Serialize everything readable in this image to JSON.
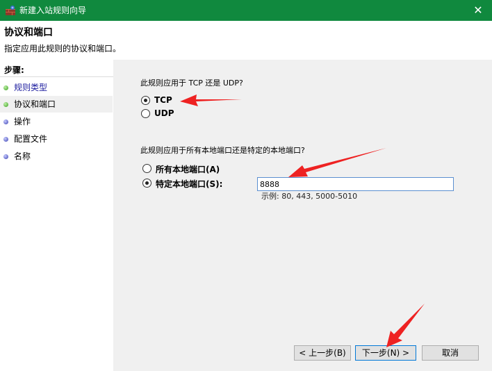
{
  "window": {
    "title": "新建入站规则向导",
    "close_glyph": "✕"
  },
  "header": {
    "title": "协议和端口",
    "subtitle": "指定应用此规则的协议和端口。"
  },
  "sidebar": {
    "steps_label": "步骤:",
    "items": [
      {
        "label": "规则类型",
        "dot": "green"
      },
      {
        "label": "协议和端口",
        "dot": "green"
      },
      {
        "label": "操作",
        "dot": "blue"
      },
      {
        "label": "配置文件",
        "dot": "blue"
      },
      {
        "label": "名称",
        "dot": "blue"
      }
    ]
  },
  "protocol": {
    "question": "此规则应用于 TCP 还是 UDP?",
    "options": [
      {
        "label": "TCP",
        "checked": true
      },
      {
        "label": "UDP",
        "checked": false
      }
    ]
  },
  "ports": {
    "question": "此规则应用于所有本地端口还是特定的本地端口?",
    "all_label": "所有本地端口(A)",
    "specific_label": "特定本地端口(S):",
    "value": "8888",
    "example": "示例: 80, 443, 5000-5010"
  },
  "buttons": {
    "back": "< 上一步(B)",
    "next": "下一步(N) >",
    "cancel": "取消"
  },
  "colors": {
    "titlebar": "#10893e",
    "annotation_arrow": "#ee2222"
  }
}
